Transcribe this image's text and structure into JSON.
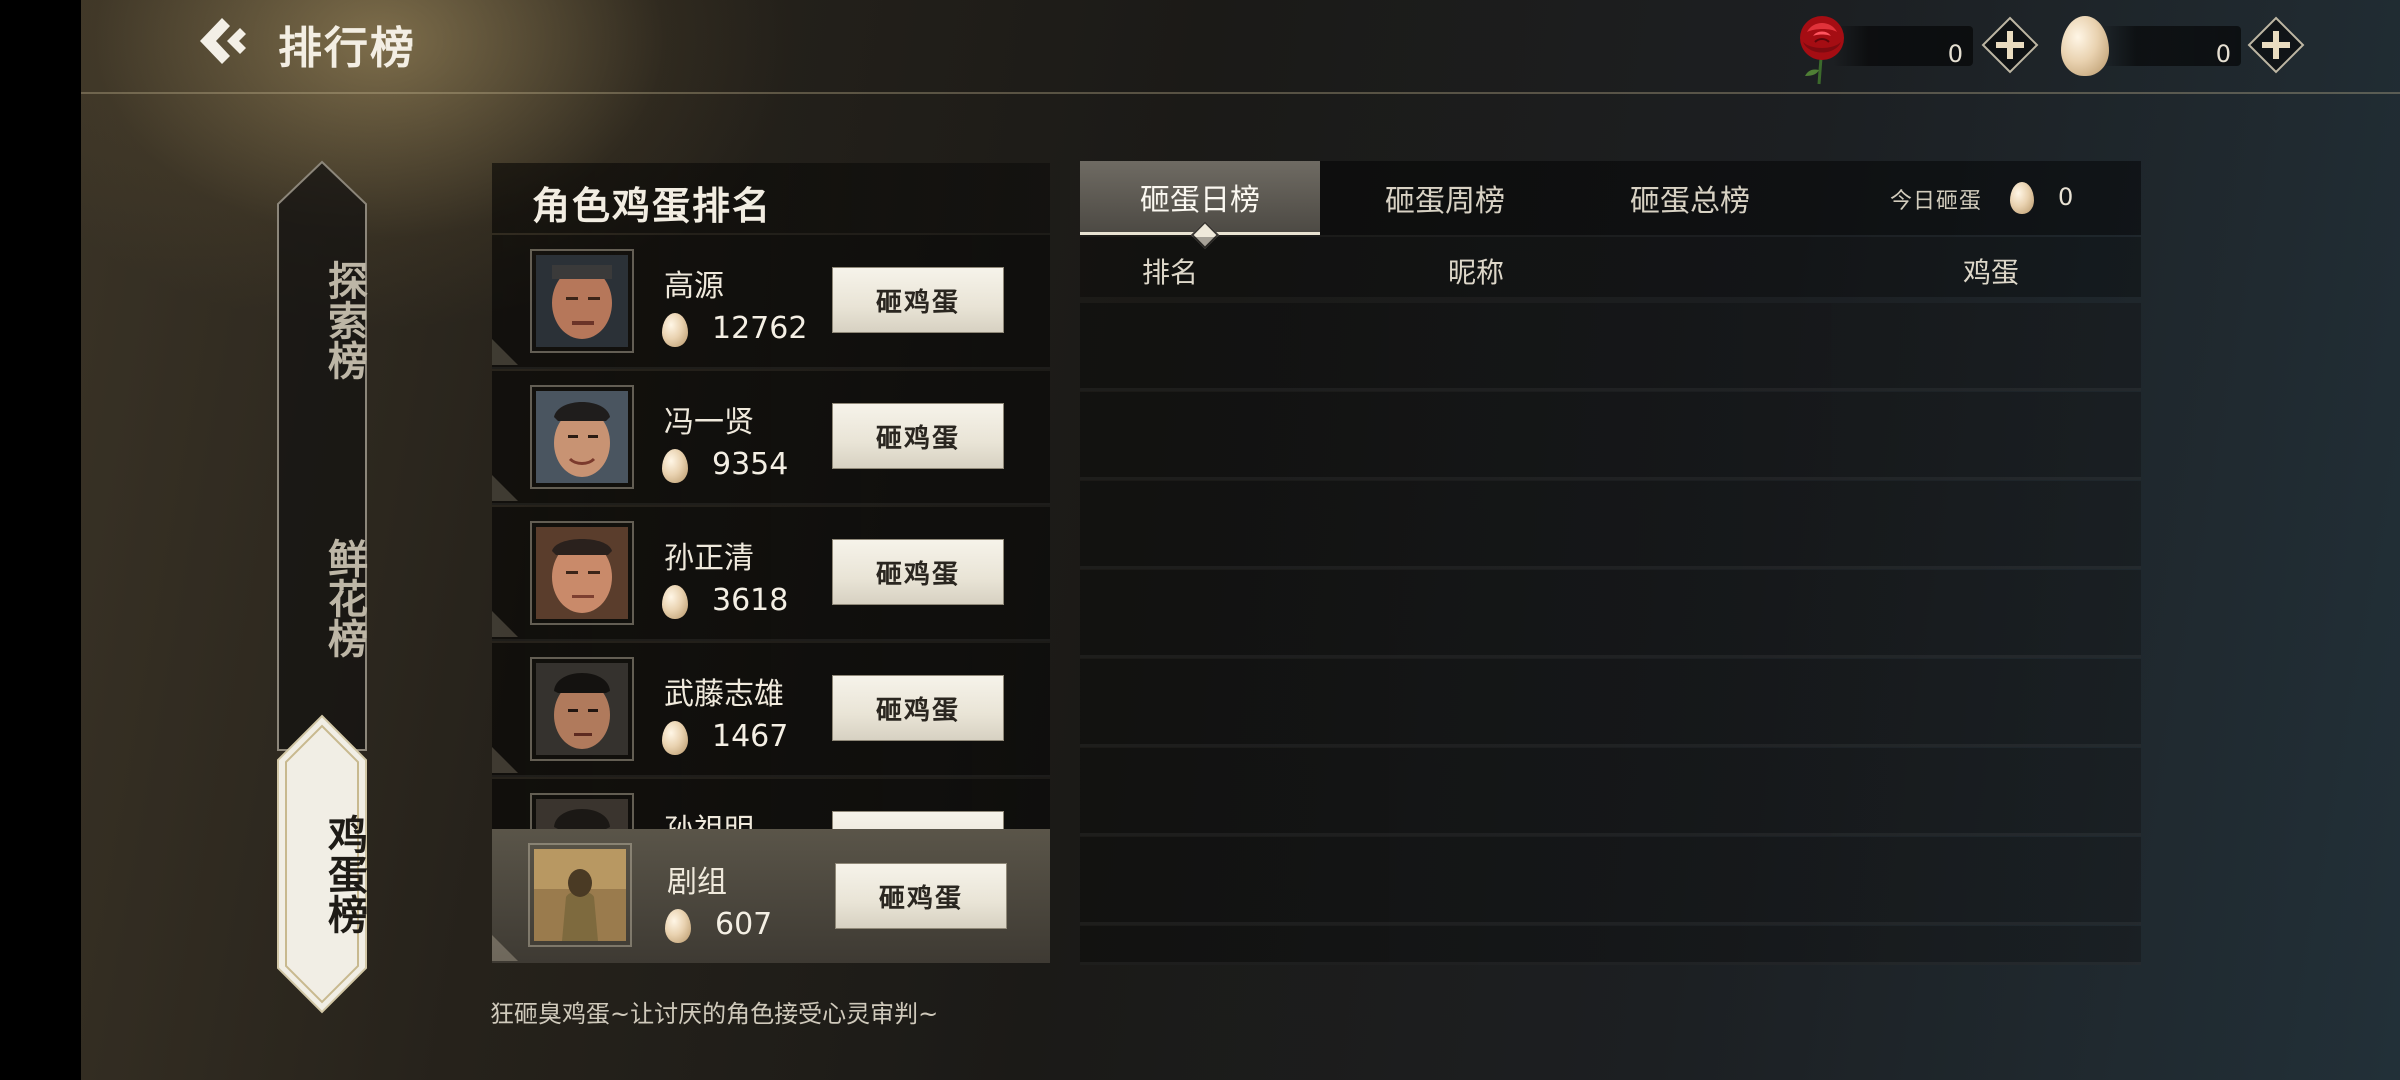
{
  "header": {
    "title": "排行榜",
    "back_icon": "double-chevron-left-icon",
    "currencies": [
      {
        "icon": "rose-icon",
        "count": "0"
      },
      {
        "icon": "egg-icon",
        "count": "0"
      }
    ]
  },
  "side_nav": {
    "items": [
      {
        "label": "探索榜",
        "active": false
      },
      {
        "label": "鲜花榜",
        "active": false
      },
      {
        "label": "鸡蛋榜",
        "active": true
      }
    ]
  },
  "rank_panel": {
    "title": "角色鸡蛋排名",
    "smash_label": "砸鸡蛋",
    "rows": [
      {
        "name": "高源",
        "eggs": "12762"
      },
      {
        "name": "冯一贤",
        "eggs": "9354"
      },
      {
        "name": "孙正清",
        "eggs": "3618"
      },
      {
        "name": "武藤志雄",
        "eggs": "1467"
      },
      {
        "name": "孙祖明",
        "eggs": ""
      }
    ],
    "crew": {
      "name": "剧组",
      "eggs": "607"
    }
  },
  "tagline": "狂砸臭鸡蛋~让讨厌的角色接受心灵审判~",
  "board": {
    "tabs": [
      {
        "label": "砸蛋日榜",
        "active": true
      },
      {
        "label": "砸蛋周榜",
        "active": false
      },
      {
        "label": "砸蛋总榜",
        "active": false
      }
    ],
    "today_label": "今日砸蛋",
    "today_count": "0",
    "columns": {
      "rank": "排名",
      "nickname": "昵称",
      "eggs": "鸡蛋"
    },
    "rows": []
  },
  "colors": {
    "accent": "#efe9da",
    "panel": "#151412",
    "active_tab": "#5e5a53",
    "rose": "#c4151c"
  }
}
